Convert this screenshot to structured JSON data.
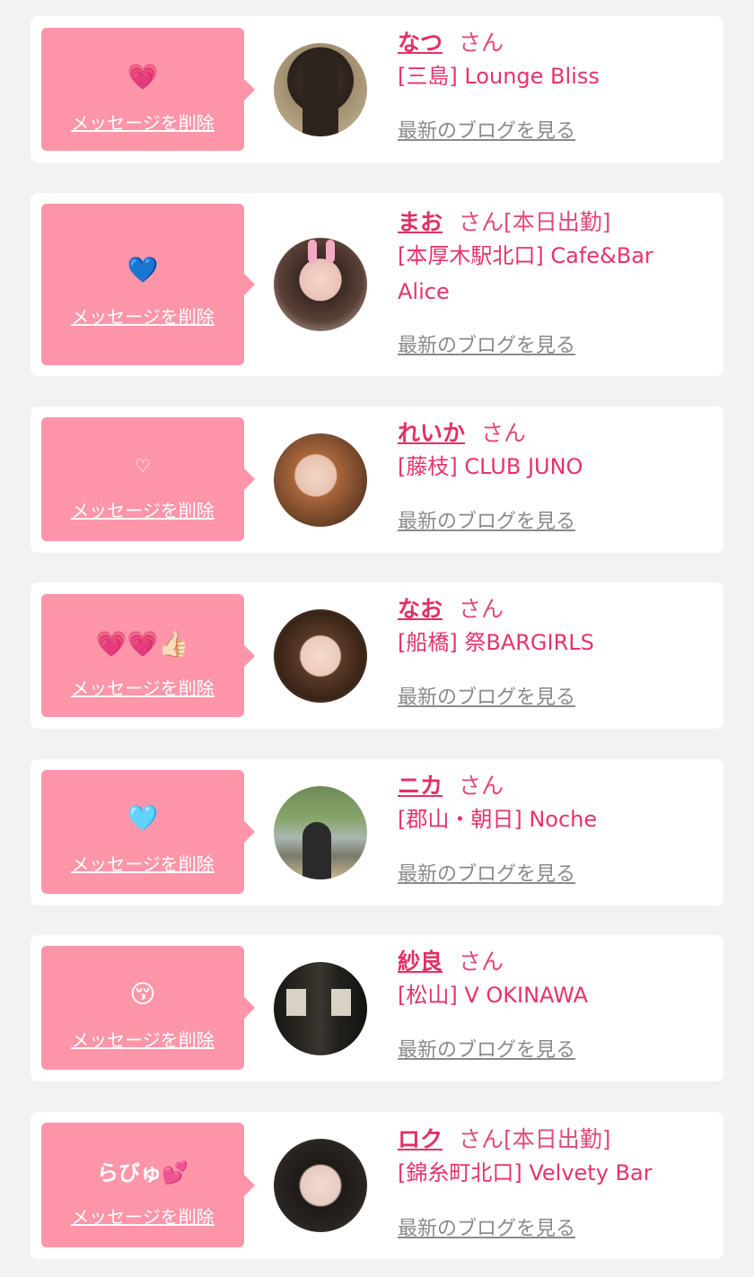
{
  "delete_label": "メッセージを削除",
  "blog_label": "最新のブログを見る",
  "honorific": "さん",
  "colors": {
    "bubble": "#fe95a9",
    "name": "#e23064",
    "shop": "#e5336b",
    "link": "#8a8a8a",
    "background": "#f2f2f2"
  },
  "items": [
    {
      "name": "なつ",
      "status": "",
      "shop_lines": [
        "[三島] Lounge Bliss"
      ],
      "message": "💗"
    },
    {
      "name": "まお",
      "status": "[本日出勤]",
      "shop_lines": [
        "[本厚木駅北口] Cafe&Bar",
        "Alice"
      ],
      "message": "💙"
    },
    {
      "name": "れいか",
      "status": "",
      "shop_lines": [
        "[藤枝] CLUB JUNO"
      ],
      "message": "♡"
    },
    {
      "name": "なお",
      "status": "",
      "shop_lines": [
        "[船橋] 祭BARGIRLS"
      ],
      "message": "💗💗👍🏻"
    },
    {
      "name": "ニカ",
      "status": "",
      "shop_lines": [
        "[郡山・朝日] Noche"
      ],
      "message": "🩵"
    },
    {
      "name": "紗良",
      "status": "",
      "shop_lines": [
        "[松山] V OKINAWA"
      ],
      "message": "😚"
    },
    {
      "name": "ロク",
      "status": "[本日出勤]",
      "shop_lines": [
        "[錦糸町北口] Velvety Bar"
      ],
      "message": "らびゅ💕"
    }
  ]
}
